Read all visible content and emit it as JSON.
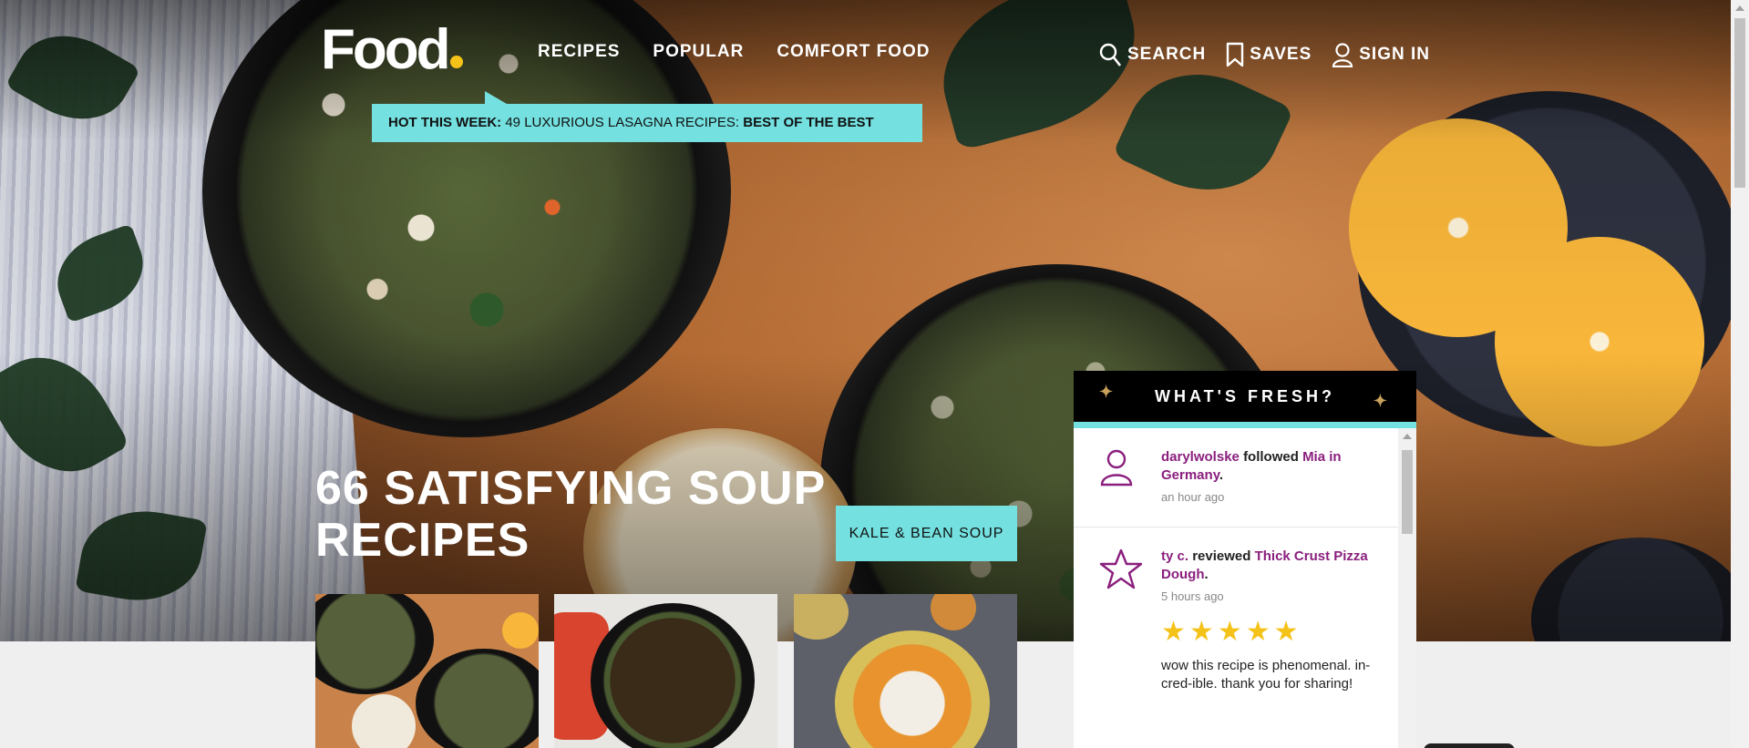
{
  "header": {
    "logo": "Food",
    "nav_left": [
      "RECIPES",
      "POPULAR",
      "COMFORT FOOD"
    ],
    "nav_right": {
      "search": "SEARCH",
      "saves": "SAVES",
      "sign_in": "SIGN IN"
    }
  },
  "promo": {
    "label": "HOT THIS WEEK:",
    "title": "49 LUXURIOUS LASAGNA RECIPES:",
    "emphasis": "BEST OF THE BEST"
  },
  "hero": {
    "headline": "66 SATISFYING SOUP RECIPES",
    "tag_button": "KALE & BEAN SOUP"
  },
  "fresh": {
    "title": "WHAT'S FRESH?",
    "entries": [
      {
        "icon": "user-icon",
        "user": "darylwolske",
        "action": "followed",
        "target": "Mia in Germany",
        "time": "an hour ago"
      },
      {
        "icon": "star-outline-icon",
        "user": "ty c.",
        "action": "reviewed",
        "target": "Thick Crust Pizza Dough",
        "time": "5 hours ago",
        "rating": 5,
        "review": "wow this recipe is phenomenal. in-cred-ible. thank you for sharing!"
      }
    ]
  },
  "colors": {
    "accent": "#74e0e0",
    "brand_dot": "#f5c21a",
    "link": "#8a1f7e"
  }
}
